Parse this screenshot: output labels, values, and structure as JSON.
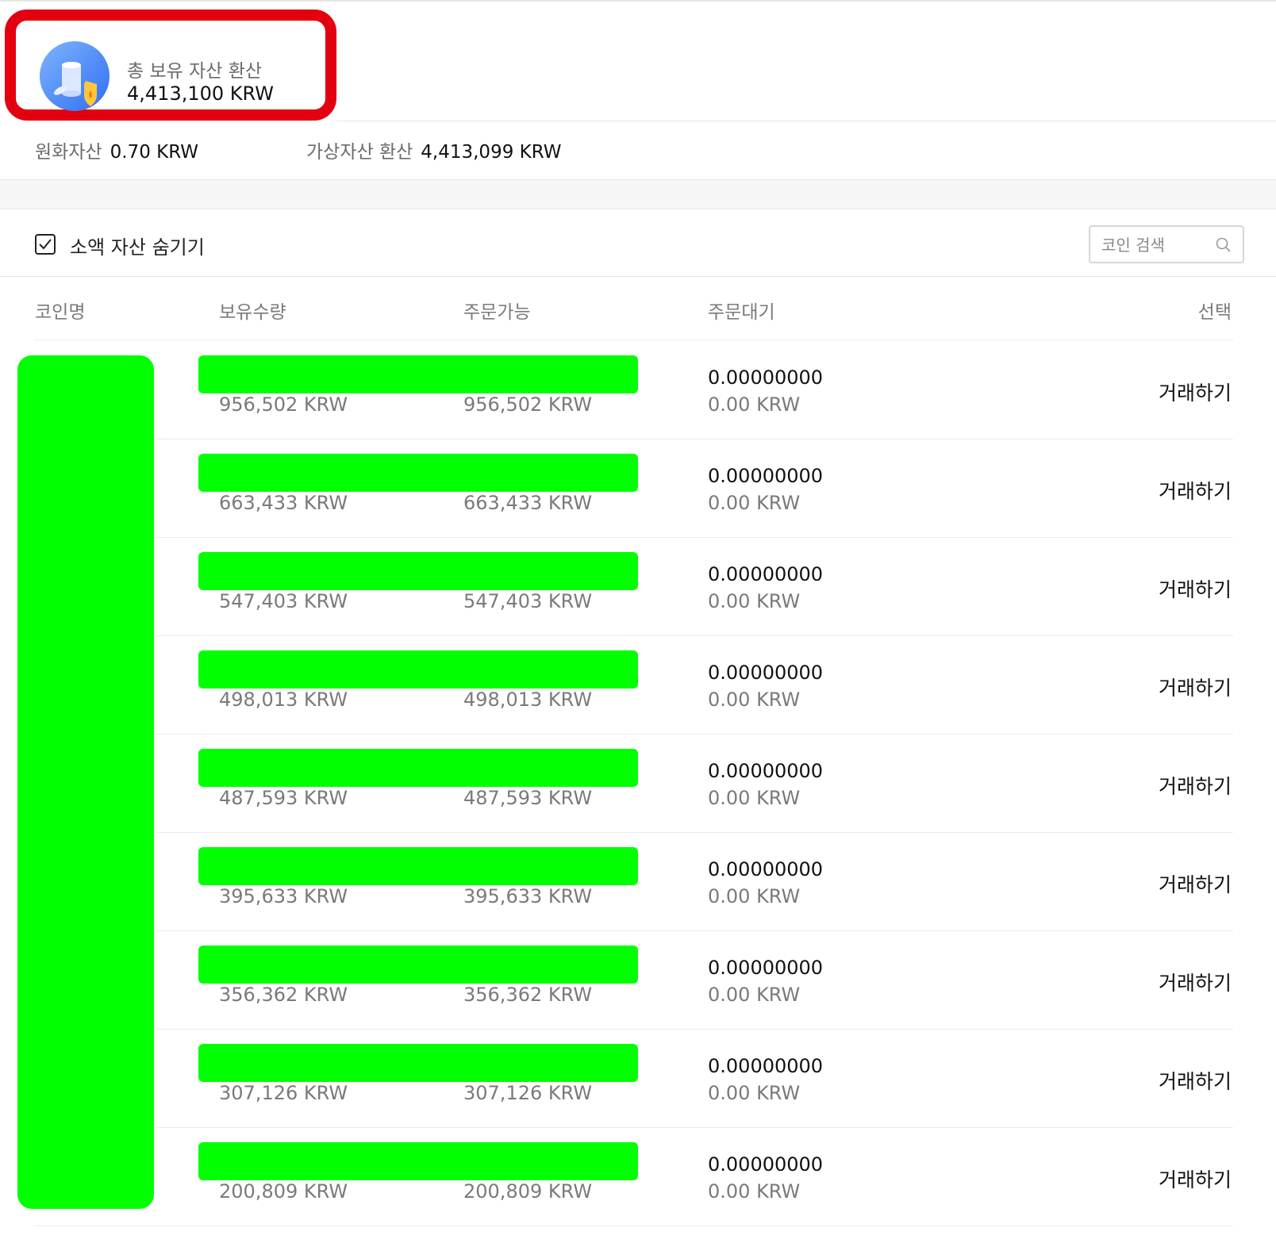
{
  "summary": {
    "label": "총 보유 자산 환산",
    "value": "4,413,100 KRW",
    "krw_label": "원화자산",
    "krw_value": "0.70 KRW",
    "crypto_label": "가상자산 환산",
    "crypto_value": "4,413,099 KRW",
    "highlight_color": "#e3000f"
  },
  "toolbar": {
    "hide_small_label": "소액 자산 숨기기",
    "hide_small_checked": true,
    "search_placeholder": "코인 검색"
  },
  "table": {
    "headers": [
      "코인명",
      "보유수량",
      "주문가능",
      "주문대기",
      "선택"
    ],
    "redaction_color": "#00ff00",
    "rows": [
      {
        "hold_krw": "956,502 KRW",
        "avail_krw": "956,502 KRW",
        "wait_amount": "0.00000000",
        "wait_krw": "0.00 KRW",
        "action": "거래하기"
      },
      {
        "hold_krw": "663,433 KRW",
        "avail_krw": "663,433 KRW",
        "wait_amount": "0.00000000",
        "wait_krw": "0.00 KRW",
        "action": "거래하기"
      },
      {
        "hold_krw": "547,403 KRW",
        "avail_krw": "547,403 KRW",
        "wait_amount": "0.00000000",
        "wait_krw": "0.00 KRW",
        "action": "거래하기"
      },
      {
        "hold_krw": "498,013 KRW",
        "avail_krw": "498,013 KRW",
        "wait_amount": "0.00000000",
        "wait_krw": "0.00 KRW",
        "action": "거래하기"
      },
      {
        "hold_krw": "487,593 KRW",
        "avail_krw": "487,593 KRW",
        "wait_amount": "0.00000000",
        "wait_krw": "0.00 KRW",
        "action": "거래하기"
      },
      {
        "hold_krw": "395,633 KRW",
        "avail_krw": "395,633 KRW",
        "wait_amount": "0.00000000",
        "wait_krw": "0.00 KRW",
        "action": "거래하기"
      },
      {
        "hold_krw": "356,362 KRW",
        "avail_krw": "356,362 KRW",
        "wait_amount": "0.00000000",
        "wait_krw": "0.00 KRW",
        "action": "거래하기"
      },
      {
        "hold_krw": "307,126 KRW",
        "avail_krw": "307,126 KRW",
        "wait_amount": "0.00000000",
        "wait_krw": "0.00 KRW",
        "action": "거래하기"
      },
      {
        "hold_krw": "200,809 KRW",
        "avail_krw": "200,809 KRW",
        "wait_amount": "0.00000000",
        "wait_krw": "0.00 KRW",
        "action": "거래하기"
      }
    ]
  }
}
